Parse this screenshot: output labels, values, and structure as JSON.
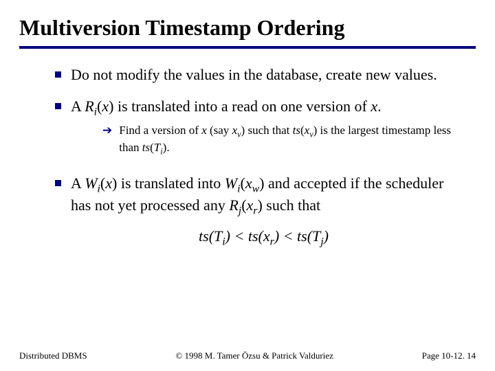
{
  "title": "Multiversion Timestamp Ordering",
  "bullets": {
    "b1": "Do not modify the values in the database, create new values.",
    "b2_pre": "A ",
    "b2_post": " is translated into a read on one version of ",
    "b2_x": "x",
    "b2_dot": ".",
    "b2_sub_pre": "Find a version of ",
    "b2_sub_mid1": " (say ",
    "b2_sub_mid2": ") such that ",
    "b2_sub_mid3": " is the largest timestamp less than ",
    "b2_sub_end": ".",
    "b3_pre": "A ",
    "b3_mid1": " is translated into ",
    "b3_mid2": " and accepted if the scheduler has not yet processed any ",
    "b3_mid3": " such that"
  },
  "expr": {
    "R": "R",
    "W": "W",
    "i": "i",
    "j": "j",
    "v": "v",
    "w": "w",
    "r": "r",
    "x": "x",
    "ts": "ts",
    "T": "T",
    "lp": "(",
    "rp": ")",
    "lt": " < "
  },
  "footer": {
    "left": "Distributed DBMS",
    "center": "© 1998 M. Tamer Özsu & Patrick Valduriez",
    "right": "Page 10-12. 14"
  }
}
